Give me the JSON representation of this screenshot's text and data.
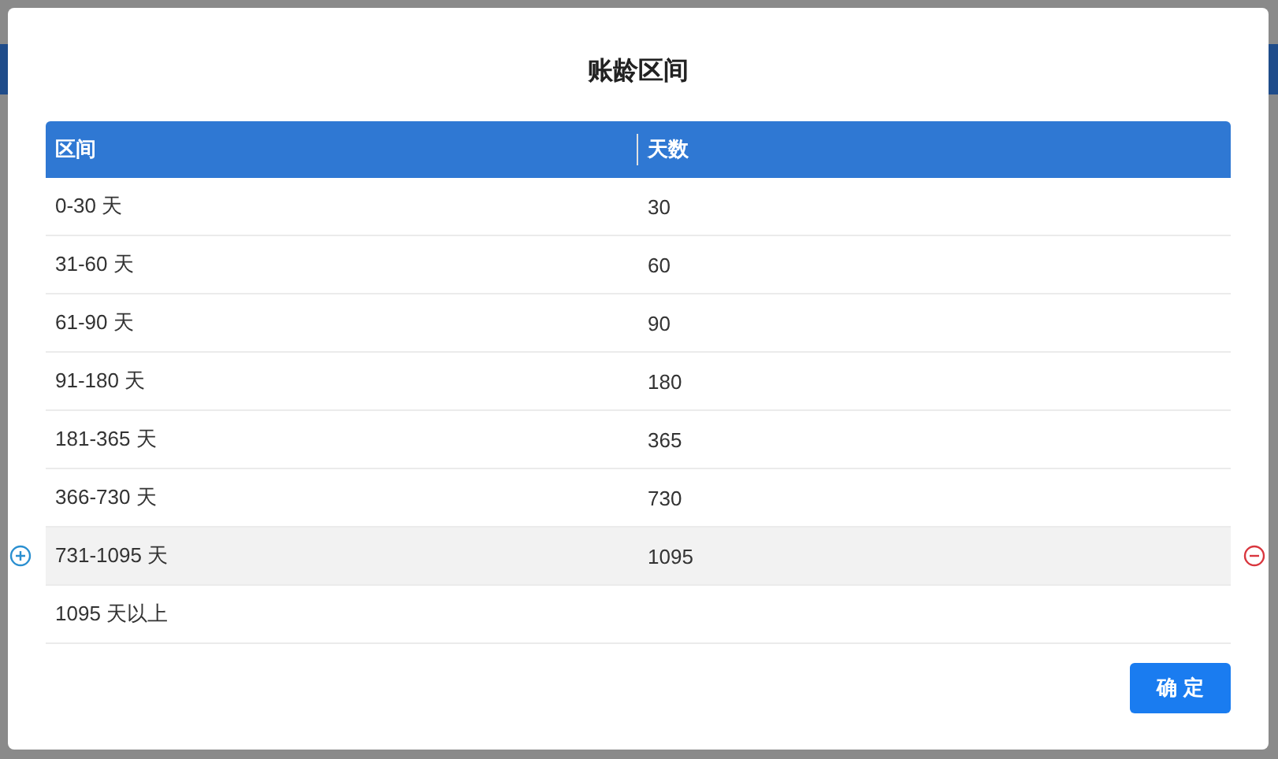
{
  "dialog": {
    "title": "账龄区间"
  },
  "table": {
    "columns": [
      "区间",
      "天数"
    ],
    "rows": [
      {
        "range": "0-30 天",
        "days": "30",
        "hovered": false
      },
      {
        "range": "31-60 天",
        "days": "60",
        "hovered": false
      },
      {
        "range": "61-90 天",
        "days": "90",
        "hovered": false
      },
      {
        "range": "91-180 天",
        "days": "180",
        "hovered": false
      },
      {
        "range": "181-365 天",
        "days": "365",
        "hovered": false
      },
      {
        "range": "366-730 天",
        "days": "730",
        "hovered": false
      },
      {
        "range": "731-1095 天",
        "days": "1095",
        "hovered": true
      },
      {
        "range": "1095 天以上",
        "days": "",
        "hovered": false
      }
    ]
  },
  "buttons": [
    "确 定"
  ]
}
